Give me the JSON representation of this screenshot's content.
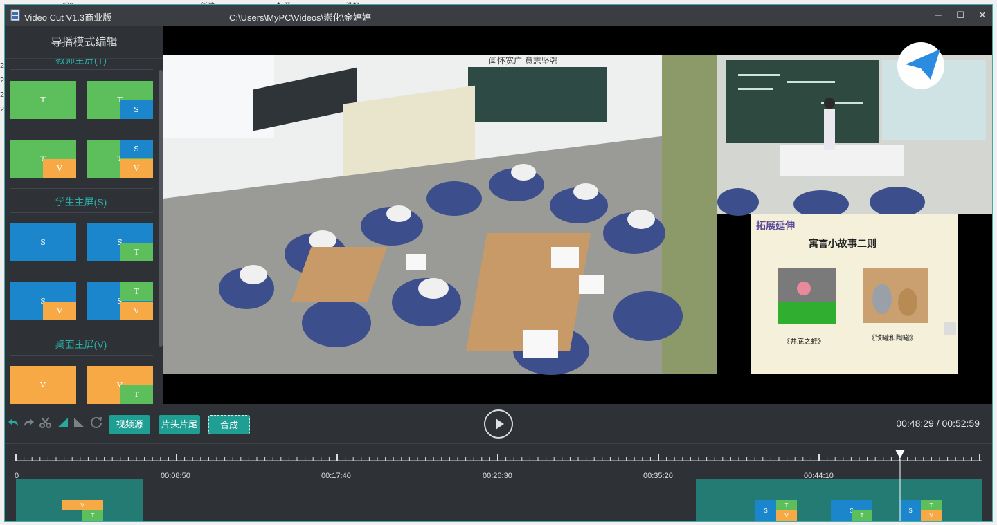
{
  "background_window": {
    "fragments": [
      "组织",
      "新建",
      "打开",
      "选择",
      "2",
      "2",
      "2",
      "2"
    ]
  },
  "window": {
    "title": "Video Cut V1.3商业版",
    "path": "C:\\Users\\MyPC\\Videos\\崇化\\金婷婷",
    "controls": {
      "minimize": "─",
      "maximize": "☐",
      "close": "✕"
    }
  },
  "sidebar": {
    "header": "导播模式编辑",
    "sections": [
      {
        "title": "教师主屏(T)"
      },
      {
        "title": "学生主屏(S)"
      },
      {
        "title": "桌面主屏(V)"
      }
    ],
    "letters": {
      "teacher": "T",
      "student": "S",
      "desktop": "V"
    }
  },
  "preview": {
    "slide_heading": "拓展延伸",
    "slide_title": "寓言小故事二则",
    "slide_caption_left": "《井底之蛙》",
    "slide_caption_right": "《铁罐和陶罐》",
    "classroom_banner": "闻怀宽广 意志坚强"
  },
  "toolbar": {
    "buttons": {
      "source": "视频源",
      "head_tail": "片头片尾",
      "compose": "合成"
    },
    "icons": [
      "undo-icon",
      "redo-icon",
      "scissors-icon",
      "fade-in-icon",
      "fade-out-icon",
      "refresh-icon"
    ],
    "time_current": "00:48:29",
    "time_separator": " / ",
    "time_total": "00:52:59"
  },
  "timeline": {
    "tick_labels": [
      "0",
      "00:08:50",
      "00:17:40",
      "00:26:30",
      "00:35:20",
      "00:44:10"
    ],
    "playhead_fraction": 0.915
  },
  "colors": {
    "teacher": "#5cbf5c",
    "student": "#1b86cb",
    "desktop": "#f7a945",
    "accent": "#1f9e94",
    "clip": "#237b74",
    "panel": "#2e3236"
  }
}
